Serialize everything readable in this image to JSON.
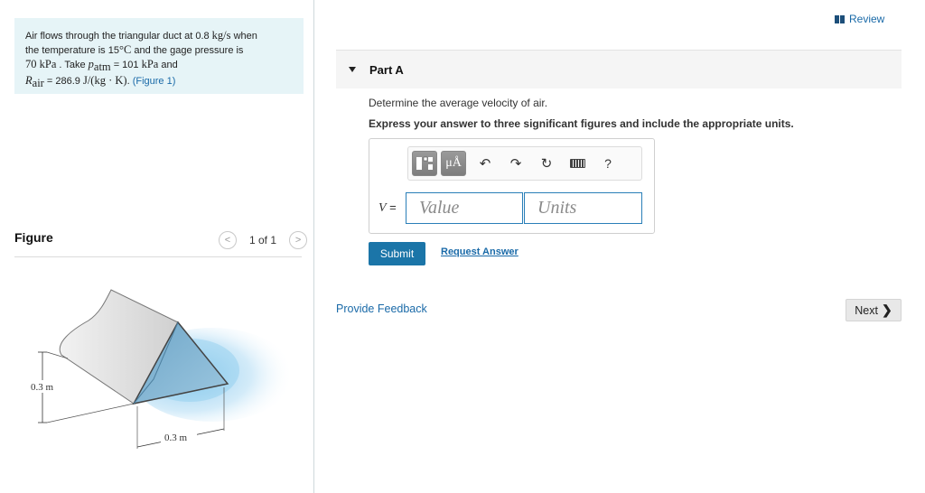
{
  "problem": {
    "line1_pre": "Air flows through the triangular duct at 0.8 ",
    "line1_unit": "kg/s",
    "line1_post": " when",
    "line2_pre": "the temperature is 15",
    "line2_unit": "°C",
    "line2_post": " and the gage pressure is",
    "line3_val": "70 kPa",
    "line3_mid": " . Take ",
    "line3_var": "p",
    "line3_sub": "atm",
    "line3_post": " = 101 ",
    "line3_unit": "kPa",
    "line3_end": " and",
    "line4_var": "R",
    "line4_sub": "air",
    "line4_eq": " = 286.9 ",
    "line4_unit": "J/(kg · K)",
    "line4_post": ". ",
    "figure_link": "(Figure 1)"
  },
  "figure": {
    "label": "Figure",
    "pager_text": "1 of 1",
    "prev_glyph": "<",
    "next_glyph": ">",
    "dim_height": "0.3 m",
    "dim_width": "0.3 m"
  },
  "header": {
    "review_label": "Review"
  },
  "part": {
    "title": "Part A",
    "question": "Determine the average velocity of air.",
    "instruction": "Express your answer to three significant figures and include the appropriate units."
  },
  "answer": {
    "variable": "V",
    "equals": " =",
    "value_placeholder": "Value",
    "units_placeholder": "Units",
    "toolbar": {
      "units_glyph": "μÅ",
      "undo_glyph": "↶",
      "redo_glyph": "↷",
      "reset_glyph": "↻",
      "help_glyph": "?"
    }
  },
  "actions": {
    "submit_label": "Submit",
    "request_answer_label": "Request Answer",
    "feedback_label": "Provide Feedback",
    "next_label": "Next",
    "next_glyph": "❯"
  }
}
